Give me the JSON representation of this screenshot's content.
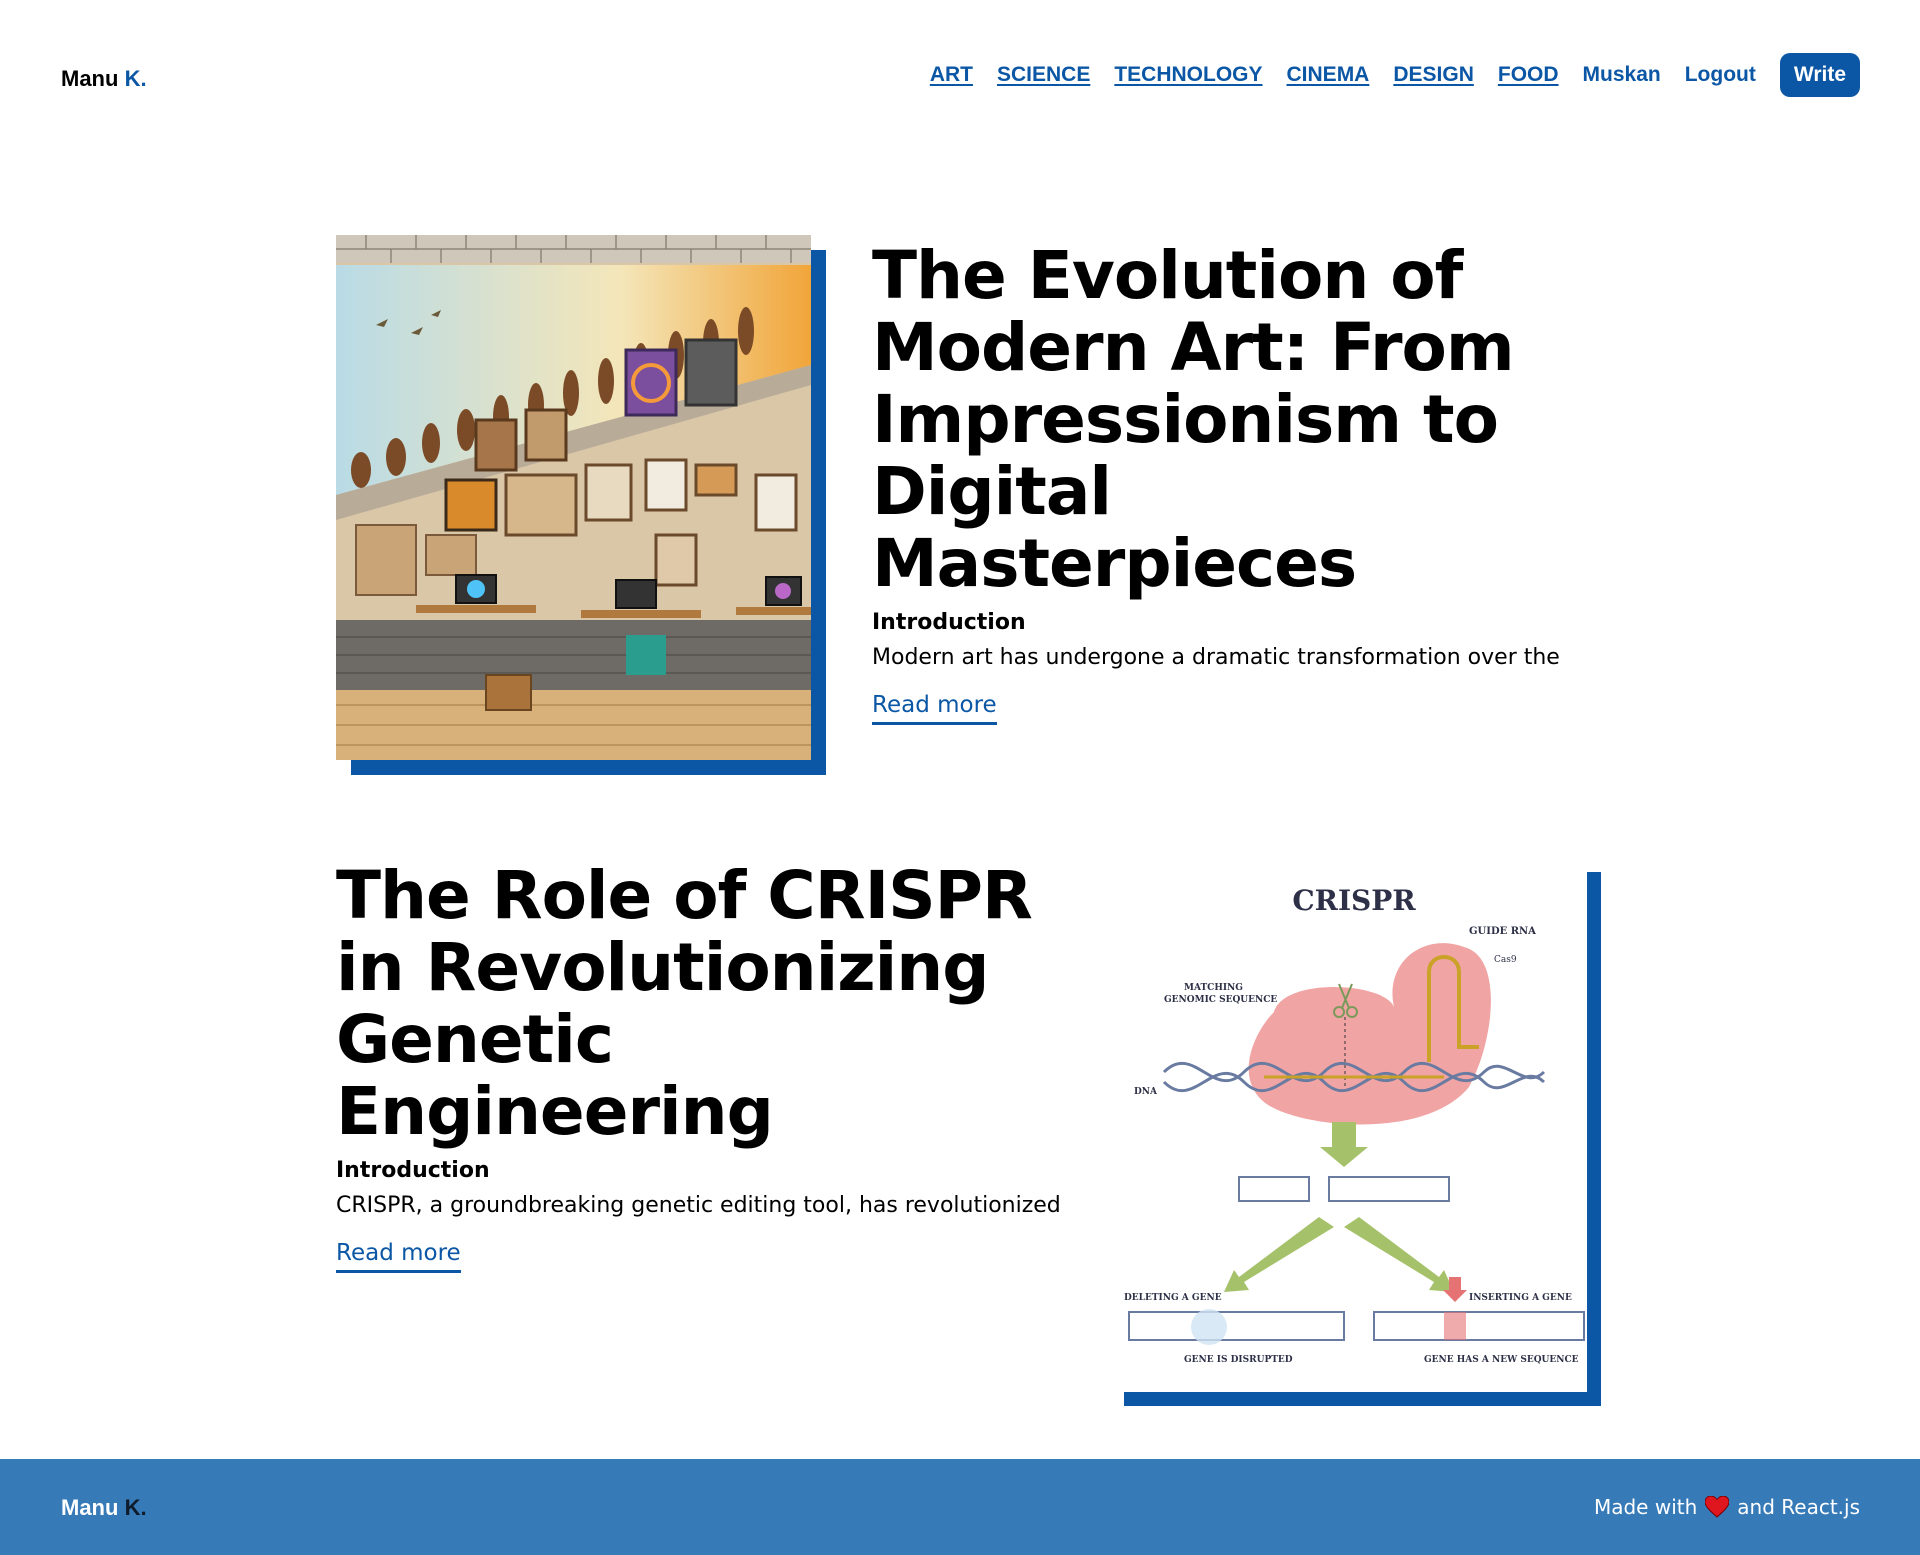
{
  "header": {
    "logo_main": "Manu",
    "logo_accent": "K.",
    "nav": {
      "categories": [
        "ART",
        "SCIENCE",
        "TECHNOLOGY",
        "CINEMA",
        "DESIGN",
        "FOOD"
      ],
      "user": "Muskan",
      "logout": "Logout",
      "write": "Write"
    }
  },
  "posts": [
    {
      "title": "The Evolution of Modern Art: From Impressionism to Digital Masterpieces",
      "subtitle": "Introduction",
      "excerpt": "Modern art has undergone a dramatic transformation over the",
      "read_more": "Read more"
    },
    {
      "title": "The Role of CRISPR in Revolutionizing Genetic Engineering",
      "subtitle": "Introduction",
      "excerpt": "CRISPR, a groundbreaking genetic editing tool, has revolutionized",
      "read_more": "Read more",
      "image_labels": {
        "title": "CRISPR",
        "guide_rna": "GUIDE RNA",
        "cas9": "Cas9",
        "matching": "MATCHING",
        "genomic": "GENOMIC SEQUENCE",
        "dna": "DNA",
        "deleting": "DELETING A GENE",
        "inserting": "INSERTING A GENE",
        "disrupted": "GENE IS DISRUPTED",
        "new_sequence": "GENE HAS A NEW SEQUENCE"
      }
    }
  ],
  "footer": {
    "logo_main": "Manu",
    "logo_accent": "K.",
    "made_with": "Made with",
    "and_react": "and React.js",
    "heart_icon": "heart-icon"
  },
  "colors": {
    "accent": "#0b57a5",
    "footer_bg": "#367ab8",
    "heart": "#e0161e"
  }
}
